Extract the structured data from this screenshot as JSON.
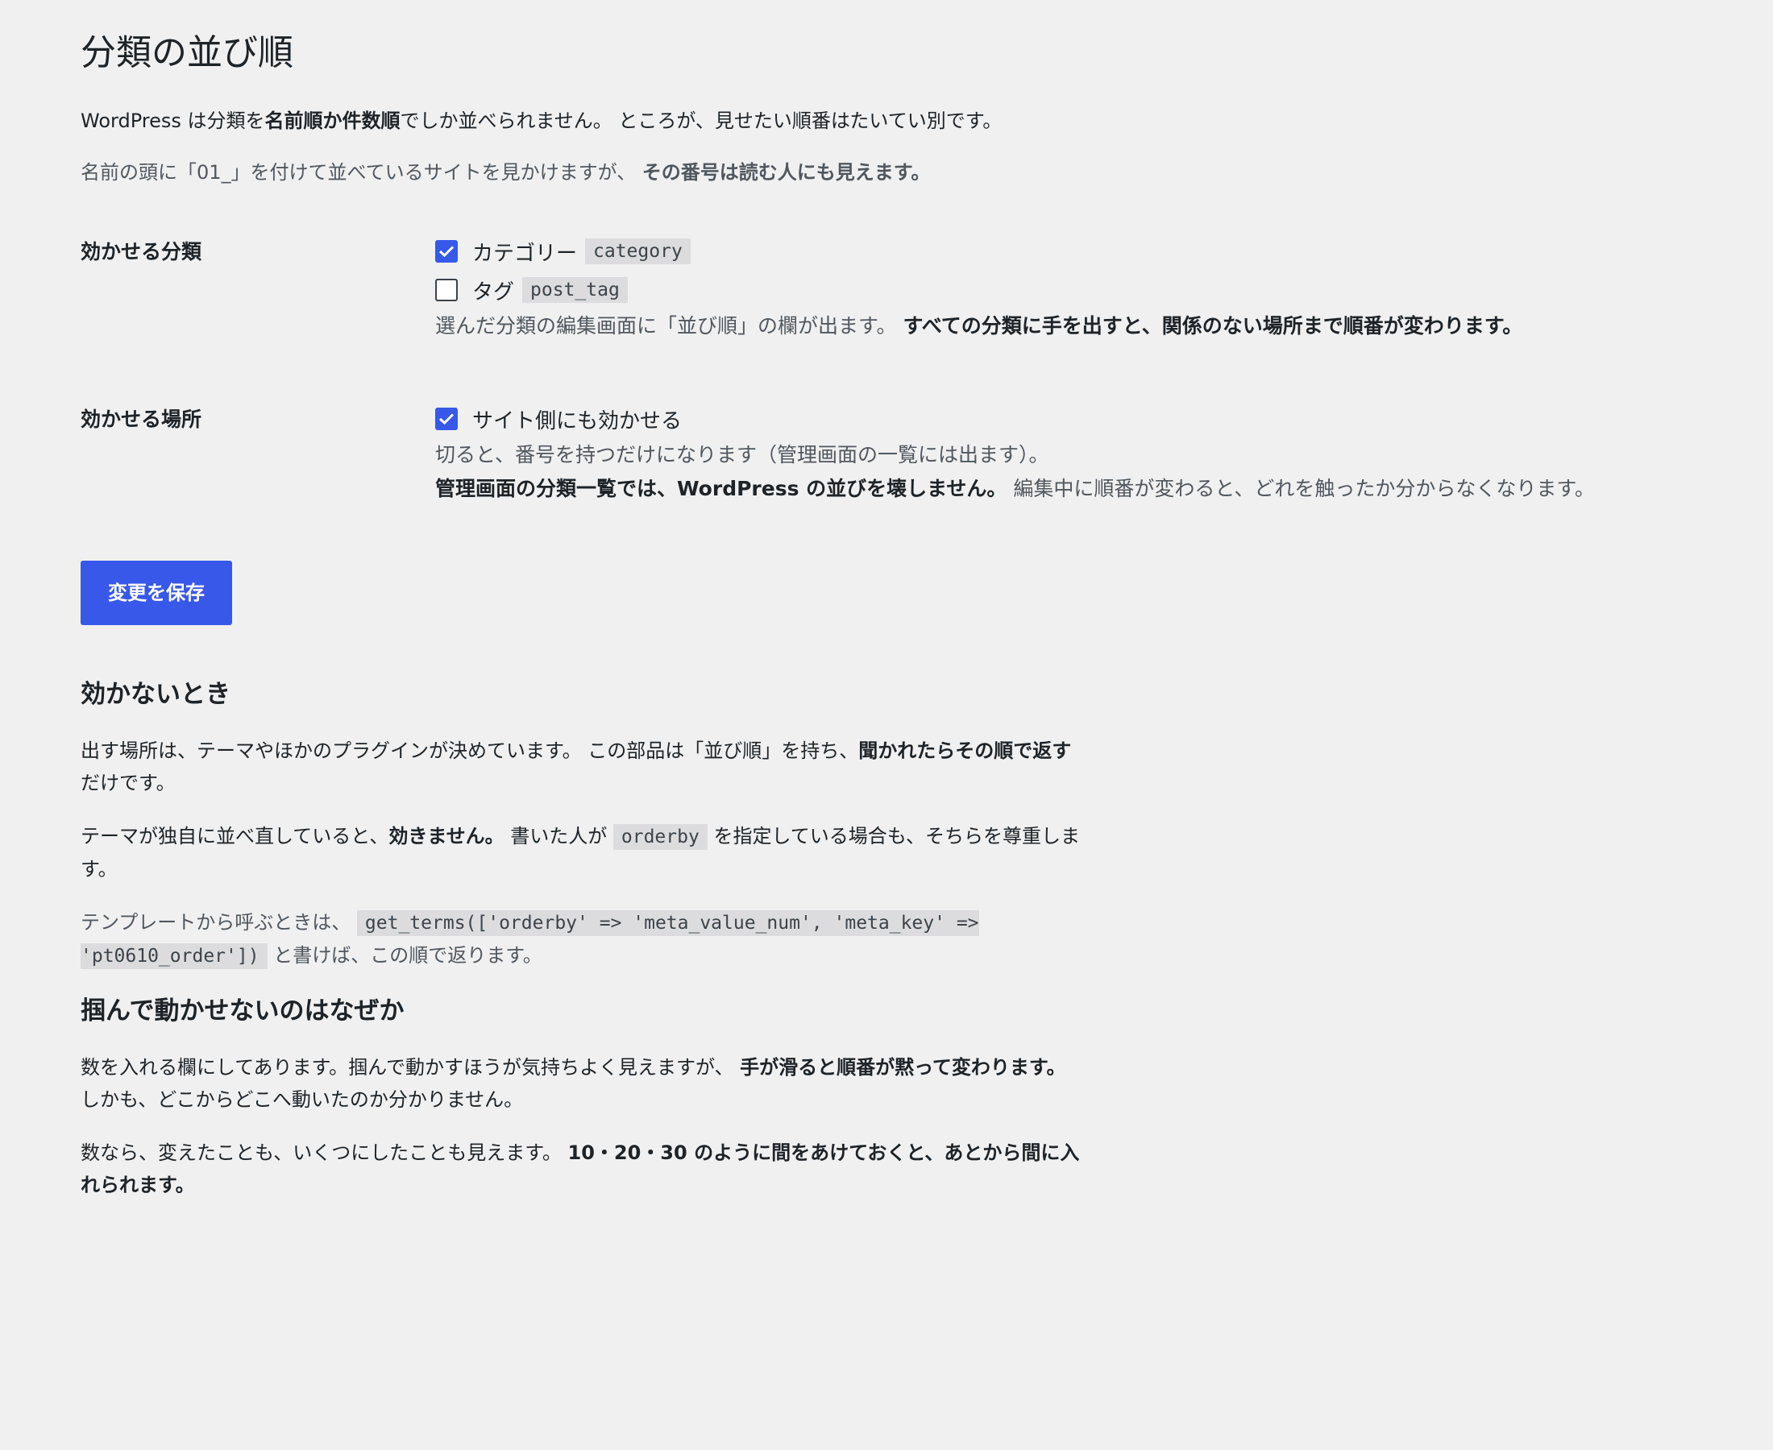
{
  "page": {
    "title": "分類の並び順",
    "intro1": {
      "a": "WordPress は分類を",
      "b": "名前順か件数順",
      "c": "でしか並べられません。 ところが、見せたい順番はたいてい別です。"
    },
    "intro2": {
      "a": "名前の頭に「01_」を付けて並べているサイトを見かけますが、 ",
      "b": "その番号は読む人にも見えます。"
    }
  },
  "taxonomies": {
    "label": "効かせる分類",
    "items": [
      {
        "label": "カテゴリー",
        "code": "category",
        "checked": true
      },
      {
        "label": "タグ",
        "code": "post_tag",
        "checked": false
      }
    ],
    "desc_a": "選んだ分類の編集画面に「並び順」の欄が出ます。 ",
    "desc_b": "すべての分類に手を出すと、関係のない場所まで順番が変わります。"
  },
  "scope": {
    "label": "効かせる場所",
    "checkbox_label": "サイト側にも効かせる",
    "checked": true,
    "desc1": "切ると、番号を持つだけになります（管理画面の一覧には出ます）。",
    "desc2_b": "管理画面の分類一覧では、WordPress の並びを壊しません。",
    "desc2_a": " 編集中に順番が変わると、どれを触ったか分からなくなります。"
  },
  "save_button": "変更を保存",
  "section1": {
    "heading": "効かないとき",
    "p1_a": "出す場所は、テーマやほかのプラグインが決めています。 この部品は「並び順」を持ち、",
    "p1_b": "聞かれたらその順で返す",
    "p1_c": "だけです。",
    "p2_a": "テーマが独自に並べ直していると、",
    "p2_b": "効きません。",
    "p2_c": " 書いた人が ",
    "p2_code": "orderby",
    "p2_d": " を指定している場合も、そちらを尊重します。",
    "p3_a": "テンプレートから呼ぶときは、 ",
    "p3_code": "get_terms(['orderby' => 'meta_value_num', 'meta_key' => 'pt0610_order'])",
    "p3_b": " と書けば、この順で返ります。"
  },
  "section2": {
    "heading": "掴んで動かせないのはなぜか",
    "p1_a": "数を入れる欄にしてあります。掴んで動かすほうが気持ちよく見えますが、 ",
    "p1_b": "手が滑ると順番が黙って変わります。",
    "p1_c": " しかも、どこからどこへ動いたのか分かりません。",
    "p2_a": "数なら、変えたことも、いくつにしたことも見えます。 ",
    "p2_b": "10・20・30 のように間をあけておくと、あとから間に入れられます。"
  },
  "colors": {
    "accent": "#3858e9",
    "background": "#f0f0f1",
    "text": "#1d2327",
    "muted": "#50575e",
    "code_bg": "#dcdcde"
  },
  "icons": {
    "checkbox_checked": "checkmark-icon"
  }
}
